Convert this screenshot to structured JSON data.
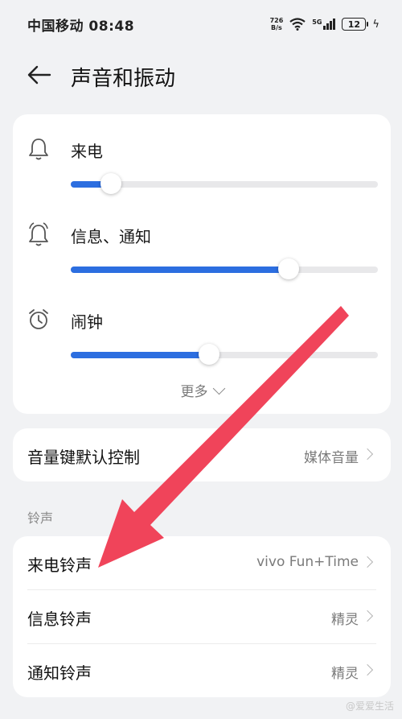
{
  "status_bar": {
    "carrier_time": "中国移动 08:48",
    "net_speed_value": "726",
    "net_speed_unit": "B/s",
    "signal_label": "5G",
    "battery": "12"
  },
  "header": {
    "title": "声音和振动"
  },
  "volume": {
    "rows": [
      {
        "label": "来电",
        "level": 0.13
      },
      {
        "label": "信息、通知",
        "level": 0.71
      },
      {
        "label": "闹钟",
        "level": 0.45
      }
    ],
    "more_label": "更多"
  },
  "volume_key": {
    "label": "音量键默认控制",
    "value": "媒体音量"
  },
  "ringtone_section": {
    "title": "铃声",
    "items": [
      {
        "label": "来电铃声",
        "value": "vivo Fun+Time"
      },
      {
        "label": "信息铃声",
        "value": "精灵"
      },
      {
        "label": "通知铃声",
        "value": "精灵"
      }
    ]
  },
  "annotation": {
    "arrow_color": "#f0445a"
  },
  "watermark": "@爱爱生活"
}
